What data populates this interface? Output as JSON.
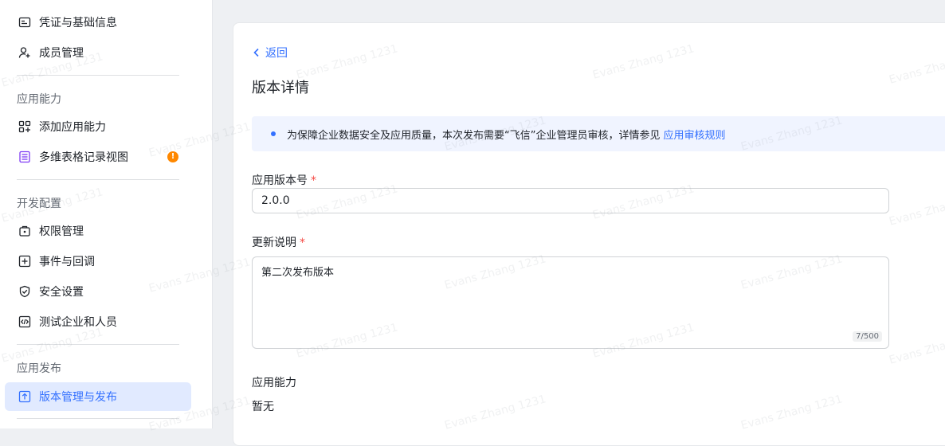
{
  "sidebar": {
    "items_top": [
      {
        "label": "凭证与基础信息",
        "icon": "credential-card-icon"
      },
      {
        "label": "成员管理",
        "icon": "user-add-icon"
      }
    ],
    "sections": [
      {
        "label": "应用能力"
      },
      {
        "label": "开发配置"
      },
      {
        "label": "应用发布"
      }
    ],
    "ability_items": [
      {
        "label": "添加应用能力",
        "icon": "apps-add-icon"
      },
      {
        "label": "多维表格记录视图",
        "icon": "table-view-icon",
        "badge": "!"
      }
    ],
    "dev_items": [
      {
        "label": "权限管理",
        "icon": "permission-lock-icon"
      },
      {
        "label": "事件与回调",
        "icon": "event-callback-icon"
      },
      {
        "label": "安全设置",
        "icon": "shield-check-icon"
      },
      {
        "label": "测试企业和人员",
        "icon": "code-test-icon"
      }
    ],
    "publish_items": [
      {
        "label": "版本管理与发布",
        "icon": "upload-version-icon",
        "active": true
      }
    ]
  },
  "main": {
    "back_label": "返回",
    "title": "版本详情",
    "notice": {
      "text": "为保障企业数据安全及应用质量，本次发布需要“飞信”企业管理员审核，详情参见",
      "link": "应用审核规则"
    },
    "version": {
      "label": "应用版本号",
      "required": "*",
      "value": "2.0.0"
    },
    "update_notes": {
      "label": "更新说明",
      "required": "*",
      "value": "第二次发布版本",
      "counter": "7/500"
    },
    "ability": {
      "label": "应用能力",
      "value": "暂无"
    }
  },
  "watermark": "Evans Zhang 1231",
  "colors": {
    "accent": "#3370ff",
    "active_bg": "#e1eaff",
    "badge": "#ff8800",
    "required": "#f54a45"
  }
}
